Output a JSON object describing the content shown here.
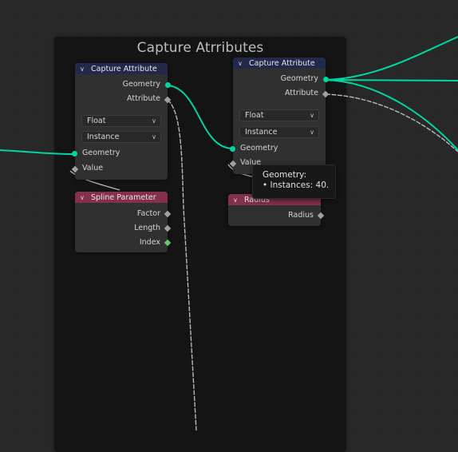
{
  "frame": {
    "title": "Capture Atrributes"
  },
  "nodes": {
    "capture_left": {
      "title": "Capture Attribute",
      "outputs": [
        "Geometry",
        "Attribute"
      ],
      "data_type": "Float",
      "domain": "Instance",
      "inputs": [
        "Geometry",
        "Value"
      ]
    },
    "capture_right": {
      "title": "Capture Attribute",
      "outputs": [
        "Geometry",
        "Attribute"
      ],
      "data_type": "Float",
      "domain": "Instance",
      "inputs": [
        "Geometry",
        "Value"
      ]
    },
    "spline_parameter": {
      "title": "Spline Parameter",
      "outputs": [
        "Factor",
        "Length",
        "Index"
      ]
    },
    "radius": {
      "title": "Radius",
      "outputs": [
        "Radius"
      ]
    }
  },
  "tooltip": {
    "line1": "Geometry:",
    "line2": "• Instances: 40."
  },
  "colors": {
    "geometry_socket": "#00d6a3",
    "float_socket": "#a1a1a1",
    "integer_socket": "#63c763",
    "attribute_header": "#22294b",
    "input_header": "#83314a"
  }
}
